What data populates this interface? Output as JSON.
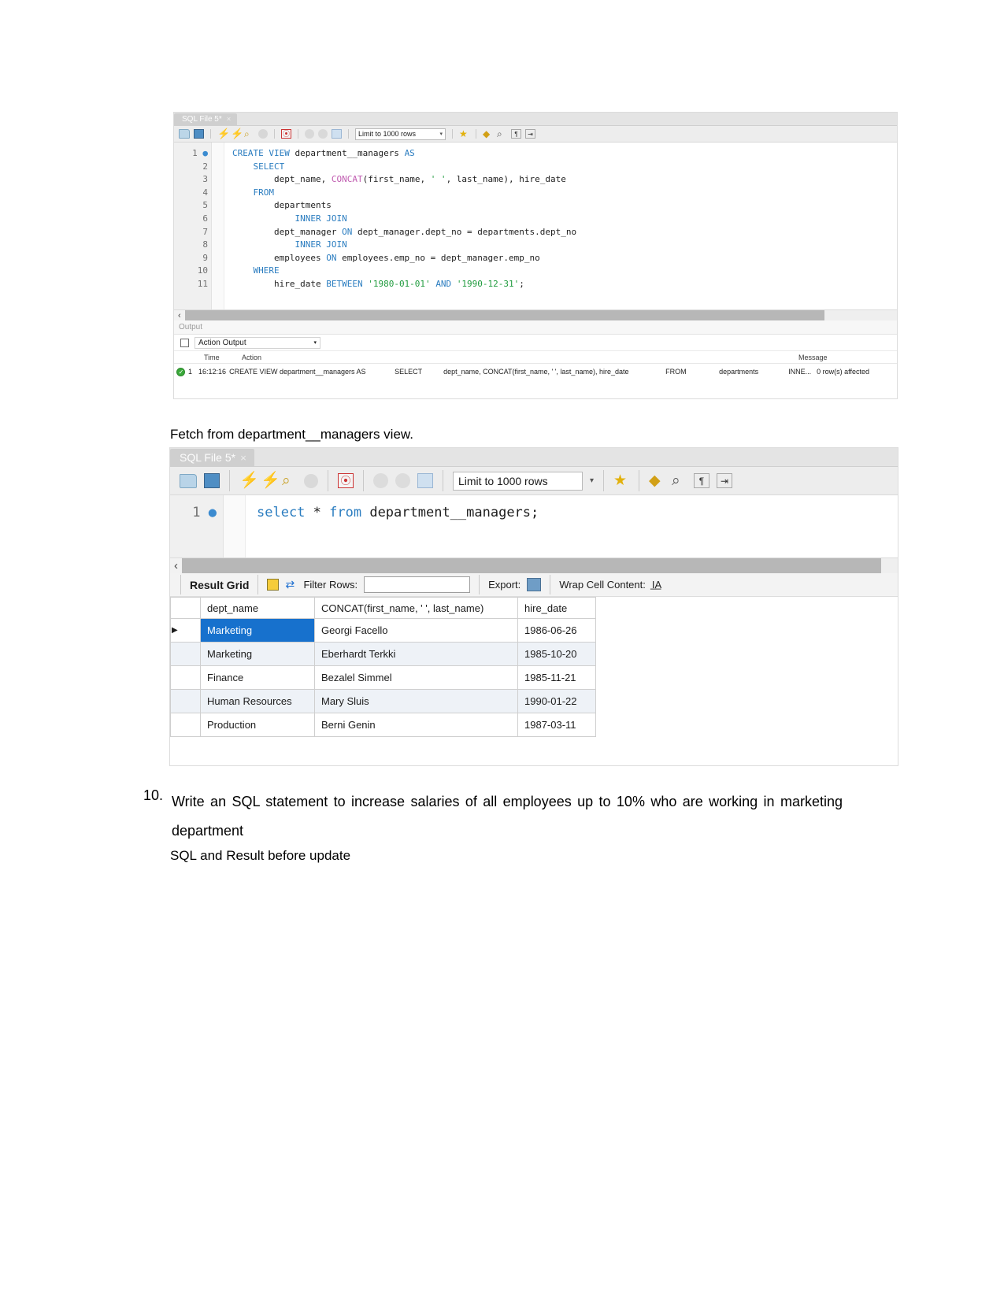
{
  "document": {
    "caption_fetch": "Fetch from department__managers view.",
    "question_number": "10.",
    "question_text": "Write an SQL statement to increase salaries of all employees up to 10% who are working in marketing department",
    "subcaption": "SQL and Result before update"
  },
  "colors": {
    "keyword": "#2b7dc0",
    "function": "#c05bb0",
    "string": "#1f9b3d",
    "selection": "#1771cd",
    "success": "#3aa93a"
  },
  "panel_one": {
    "tab": {
      "label": "SQL File 5*",
      "close": "×"
    },
    "toolbar": {
      "icons": [
        "open-file-icon",
        "save-file-icon",
        "execute-icon",
        "execute-current-statement-icon",
        "explain-icon",
        "stop-icon",
        "toggle-stop-on-error-icon",
        "commit-icon",
        "rollback-icon",
        "autocommit-icon",
        "beautify-icon",
        "find-icon",
        "toggle-invisible-chars-icon",
        "wrap-lines-icon"
      ],
      "limit_label": "Limit to 1000 rows",
      "limit_caret": "▾"
    },
    "editor": {
      "lines": [
        {
          "n": "1",
          "breakpoint": true,
          "tokens": [
            {
              "t": "CREATE VIEW",
              "c": "k"
            },
            {
              "t": " department__managers ",
              "c": ""
            },
            {
              "t": "AS",
              "c": "k"
            }
          ]
        },
        {
          "n": "2",
          "breakpoint": false,
          "tokens": [
            {
              "t": "    ",
              "c": ""
            },
            {
              "t": "SELECT",
              "c": "k"
            }
          ]
        },
        {
          "n": "3",
          "breakpoint": false,
          "tokens": [
            {
              "t": "        dept_name, ",
              "c": ""
            },
            {
              "t": "CONCAT",
              "c": "fn"
            },
            {
              "t": "(first_name, ",
              "c": ""
            },
            {
              "t": "' '",
              "c": "s"
            },
            {
              "t": ", last_name), hire_date",
              "c": ""
            }
          ]
        },
        {
          "n": "4",
          "breakpoint": false,
          "tokens": [
            {
              "t": "    ",
              "c": ""
            },
            {
              "t": "FROM",
              "c": "k"
            }
          ]
        },
        {
          "n": "5",
          "breakpoint": false,
          "tokens": [
            {
              "t": "        departments",
              "c": ""
            }
          ]
        },
        {
          "n": "6",
          "breakpoint": false,
          "tokens": [
            {
              "t": "            ",
              "c": ""
            },
            {
              "t": "INNER JOIN",
              "c": "k"
            }
          ]
        },
        {
          "n": "7",
          "breakpoint": false,
          "tokens": [
            {
              "t": "        dept_manager ",
              "c": ""
            },
            {
              "t": "ON",
              "c": "k"
            },
            {
              "t": " dept_manager.dept_no = departments.dept_no",
              "c": ""
            }
          ]
        },
        {
          "n": "8",
          "breakpoint": false,
          "tokens": [
            {
              "t": "            ",
              "c": ""
            },
            {
              "t": "INNER JOIN",
              "c": "k"
            }
          ]
        },
        {
          "n": "9",
          "breakpoint": false,
          "tokens": [
            {
              "t": "        employees ",
              "c": ""
            },
            {
              "t": "ON",
              "c": "k"
            },
            {
              "t": " employees.emp_no = dept_manager.emp_no",
              "c": ""
            }
          ]
        },
        {
          "n": "10",
          "breakpoint": false,
          "tokens": [
            {
              "t": "    ",
              "c": ""
            },
            {
              "t": "WHERE",
              "c": "k"
            }
          ]
        },
        {
          "n": "11",
          "breakpoint": false,
          "tokens": [
            {
              "t": "        hire_date ",
              "c": ""
            },
            {
              "t": "BETWEEN",
              "c": "k"
            },
            {
              "t": " ",
              "c": ""
            },
            {
              "t": "'1980-01-01'",
              "c": "s"
            },
            {
              "t": " ",
              "c": ""
            },
            {
              "t": "AND",
              "c": "k"
            },
            {
              "t": " ",
              "c": ""
            },
            {
              "t": "'1990-12-31'",
              "c": "s"
            },
            {
              "t": ";",
              "c": ""
            }
          ]
        }
      ]
    },
    "scrollbar": {
      "left_arrow": "‹"
    },
    "output": {
      "title": "Output",
      "selector": "Action Output",
      "selector_caret": "▾",
      "columns": [
        "",
        "",
        "Time",
        "Action",
        "Message"
      ],
      "rows": [
        {
          "status": "success",
          "status_glyph": "✓",
          "index": "1",
          "time": "16:12:16",
          "action_parts": [
            "CREATE VIEW department__managers AS",
            "SELECT",
            "dept_name, CONCAT(first_name, ' ', last_name), hire_date",
            "FROM",
            "departments",
            "INNE..."
          ],
          "message": "0 row(s) affected"
        }
      ]
    }
  },
  "panel_two": {
    "tab": {
      "label": "SQL File 5*",
      "close": "×"
    },
    "toolbar": {
      "icons": [
        "open-file-icon",
        "save-file-icon",
        "execute-icon",
        "execute-current-statement-icon",
        "explain-icon",
        "stop-icon",
        "toggle-stop-on-error-icon",
        "commit-icon",
        "rollback-icon",
        "autocommit-icon",
        "beautify-icon",
        "find-icon",
        "toggle-invisible-chars-icon",
        "wrap-lines-icon"
      ],
      "limit_label": "Limit to 1000 rows",
      "limit_caret": "▾"
    },
    "editor": {
      "lines": [
        {
          "n": "1",
          "breakpoint": true,
          "tokens": [
            {
              "t": "select",
              "c": "k"
            },
            {
              "t": " * ",
              "c": ""
            },
            {
              "t": "from",
              "c": "k"
            },
            {
              "t": " department__managers;",
              "c": ""
            }
          ]
        }
      ]
    },
    "scrollbar": {
      "left_arrow": "‹"
    },
    "result_toolbar": {
      "result_grid_label": "Result Grid",
      "grid-icon": "grid-view-icon",
      "refresh-icon": "refresh-icon",
      "filter_label": "Filter Rows:",
      "filter_value": "",
      "filter_placeholder": "",
      "export_label": "Export:",
      "export-icon": "export-icon",
      "wrap_label": "Wrap Cell Content:",
      "wrap-icon": "wrap-cell-icon"
    },
    "result_grid": {
      "columns": [
        "dept_name",
        "CONCAT(first_name, ' ', last_name)",
        "hire_date"
      ],
      "rows": [
        {
          "cells": [
            "Marketing",
            "Georgi Facello",
            "1986-06-26"
          ],
          "selected": true,
          "marker": "▶"
        },
        {
          "cells": [
            "Marketing",
            "Eberhardt Terkki",
            "1985-10-20"
          ],
          "selected": false,
          "marker": ""
        },
        {
          "cells": [
            "Finance",
            "Bezalel Simmel",
            "1985-11-21"
          ],
          "selected": false,
          "marker": ""
        },
        {
          "cells": [
            "Human Resources",
            "Mary Sluis",
            "1990-01-22"
          ],
          "selected": false,
          "marker": ""
        },
        {
          "cells": [
            "Production",
            "Berni Genin",
            "1987-03-11"
          ],
          "selected": false,
          "marker": ""
        }
      ]
    }
  }
}
